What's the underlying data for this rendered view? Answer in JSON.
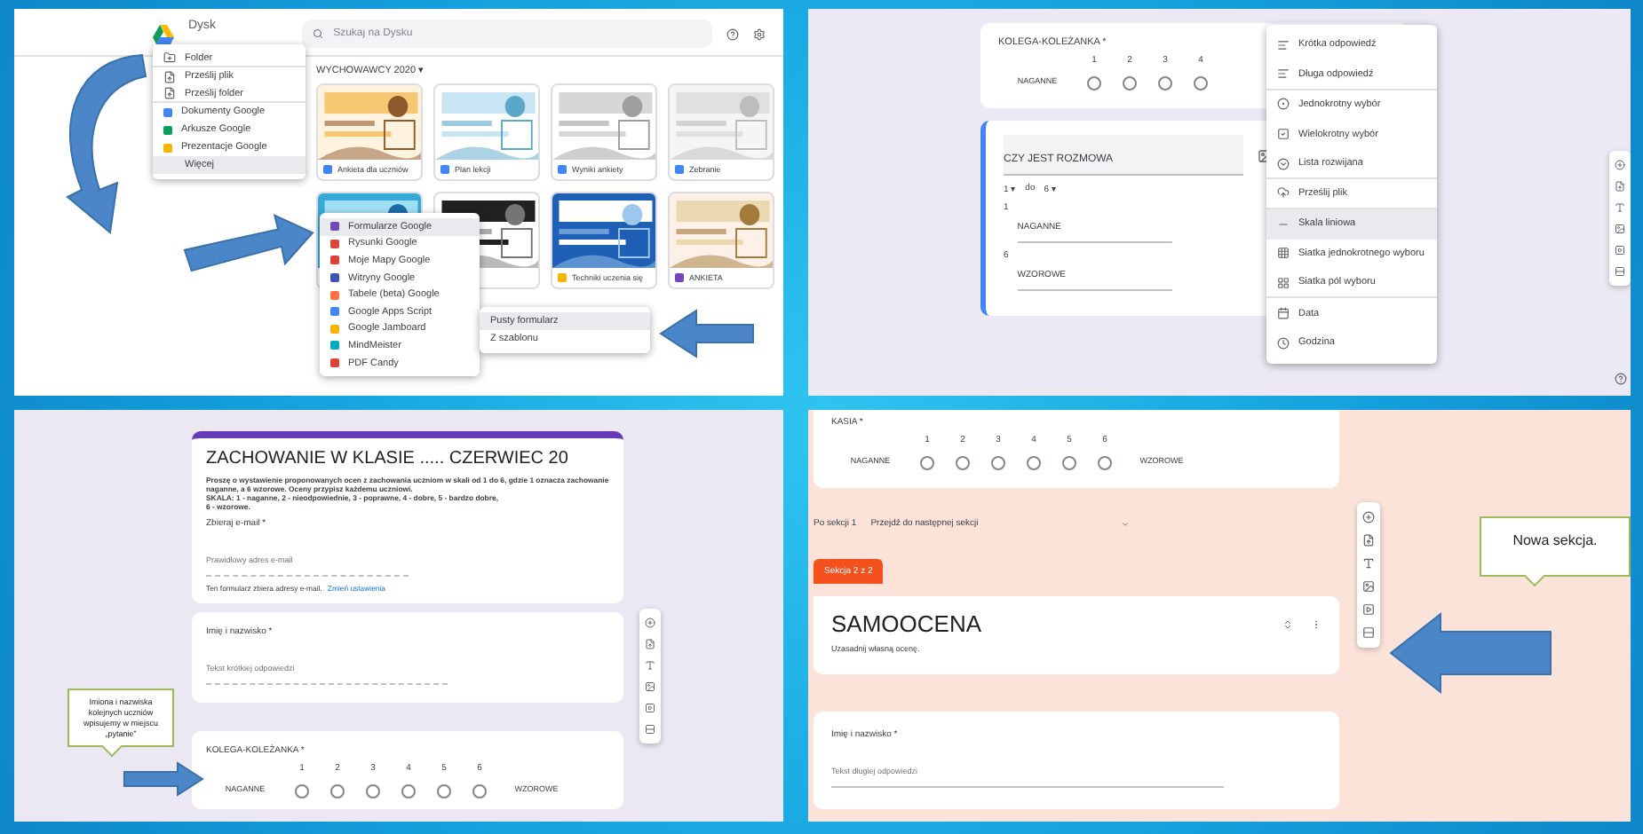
{
  "drive_screen": {
    "app_name": "Dysk",
    "search": {
      "placeholder": "Szukaj na Dysku"
    },
    "breadcrumb": "WYCHOWAWCY 2020 ▾",
    "new_menu": [
      {
        "label": "Folder",
        "kind": "folder",
        "selected": false
      },
      {
        "label": "Prześlij plik",
        "kind": "upload",
        "selected": false
      },
      {
        "label": "Prześlij folder",
        "kind": "upload",
        "selected": false
      },
      {
        "label": "Dokumenty Google",
        "kind": "app",
        "color": "#4285f4",
        "selected": false
      },
      {
        "label": "Arkusze Google",
        "kind": "app",
        "color": "#0f9d58",
        "selected": false
      },
      {
        "label": "Prezentacje Google",
        "kind": "app",
        "color": "#f4b400",
        "selected": false
      },
      {
        "label": "Więcej",
        "kind": "more",
        "selected": true
      }
    ],
    "more_menu": [
      {
        "label": "Formularze Google",
        "color": "#7248b9",
        "selected": true
      },
      {
        "label": "Rysunki Google",
        "color": "#db4437",
        "selected": false
      },
      {
        "label": "Moje Mapy Google",
        "color": "#db4437",
        "selected": false
      },
      {
        "label": "Witryny Google",
        "color": "#3f51b5",
        "selected": false
      },
      {
        "label": "Tabele (beta) Google",
        "color": "#ff7043",
        "selected": false
      },
      {
        "label": "Google Apps Script",
        "color": "#4285f4",
        "selected": false
      },
      {
        "label": "Google Jamboard",
        "color": "#f4b400",
        "selected": false
      },
      {
        "label": "MindMeister",
        "color": "#00acc1",
        "selected": false
      },
      {
        "label": "PDF Candy",
        "color": "#db4437",
        "selected": false
      }
    ],
    "form_menu": [
      {
        "label": "Pusty formularz",
        "selected": true
      },
      {
        "label": "Z szablonu",
        "selected": false
      }
    ],
    "files": [
      {
        "kind": "file",
        "caption": "Ankieta dla uczniów",
        "color": "#4285f4"
      },
      {
        "kind": "file",
        "caption": "Plan lekcji",
        "color": "#4285f4"
      },
      {
        "kind": "file",
        "caption": "Wyniki ankiety",
        "color": "#4285f4"
      },
      {
        "kind": "file",
        "caption": "Zebranie",
        "color": "#4285f4"
      },
      {
        "kind": "picture"
      },
      {
        "kind": "picture"
      },
      {
        "kind": "file",
        "caption": "Techniki uczenia się",
        "color": "#f4b400"
      },
      {
        "kind": "file",
        "caption": "ANKIETA",
        "color": "#7248b9"
      }
    ]
  },
  "question_type_screen": {
    "scale_card": {
      "title": "KOLEGA-KOLEŻANKA *",
      "points": [
        {
          "label": "1",
          "selected": false
        },
        {
          "label": "2",
          "selected": false
        },
        {
          "label": "3",
          "selected": false
        },
        {
          "label": "4",
          "selected": false
        }
      ],
      "low_label": "NAGANNE"
    },
    "edit_card": {
      "question": "CZY JEST ROZMOWA",
      "from": "1 ▾",
      "to_word": "do",
      "to": "6 ▾",
      "low": {
        "number": "1",
        "label": "NAGANNE"
      },
      "high": {
        "number": "6",
        "label": "WZOROWE"
      }
    },
    "type_menu": [
      {
        "label": "Krótka odpowiedź",
        "kind": "short",
        "selected": false
      },
      {
        "label": "Długa odpowiedź",
        "kind": "long",
        "selected": false
      },
      {
        "label": "Jednokrotny wybór",
        "kind": "radio",
        "selected": false
      },
      {
        "label": "Wielokrotny wybór",
        "kind": "check",
        "selected": false
      },
      {
        "label": "Lista rozwijana",
        "kind": "dropdown",
        "selected": false
      },
      {
        "label": "Prześlij plik",
        "kind": "upload",
        "selected": false
      },
      {
        "label": "Skala liniowa",
        "kind": "scale",
        "selected": true
      },
      {
        "label": "Siatka jednokrotnego wyboru",
        "kind": "grid",
        "selected": false
      },
      {
        "label": "Siatka pól wyboru",
        "kind": "checkgrid",
        "selected": false
      },
      {
        "label": "Data",
        "kind": "date",
        "selected": false
      },
      {
        "label": "Godzina",
        "kind": "time",
        "selected": false
      }
    ]
  },
  "form_screen": {
    "title": "ZACHOWANIE W KLASIE ..... CZERWIEC 20",
    "description": "Proszę o wystawienie proponowanych ocen z zachowania uczniom w skali od 1 do 6, gdzie 1 oznacza zachowanie naganne, a 6 wzorowe. Oceny przypisz każdemu uczniowi.\nSKALA: 1 - naganne, 2 - nieodpowiednie, 3 - poprawne, 4 - dobre, 5 - bardzo dobre,\n6 - wzorowe.",
    "email_label": "Zbieraj e-mail *",
    "email_placeholder": "Prawidłowy adres e-mail",
    "email_note": "Ten formularz zbiera adresy e-mail.",
    "email_link": "Zmień ustawienia",
    "name_label": "Imię i nazwisko *",
    "name_placeholder": "Tekst krótkiej odpowiedzi",
    "scale_card": {
      "title": "KOLEGA-KOLEŻANKA *",
      "points": [
        {
          "label": "1",
          "selected": false
        },
        {
          "label": "2",
          "selected": false
        },
        {
          "label": "3",
          "selected": false
        },
        {
          "label": "4",
          "selected": false
        },
        {
          "label": "5",
          "selected": false
        },
        {
          "label": "6",
          "selected": false
        }
      ],
      "low_label": "NAGANNE",
      "high_label": "WZOROWE"
    },
    "callout": "Imiona i nazwiska kolejnych uczniów wpisujemy w miejscu „pytanie”"
  },
  "section_screen": {
    "scale_card": {
      "title": "KASIA *",
      "points": [
        {
          "label": "1",
          "selected": false
        },
        {
          "label": "2",
          "selected": false
        },
        {
          "label": "3",
          "selected": false
        },
        {
          "label": "4",
          "selected": false
        },
        {
          "label": "5",
          "selected": false
        },
        {
          "label": "6",
          "selected": false
        }
      ],
      "low_label": "NAGANNE",
      "high_label": "WZOROWE"
    },
    "after_section": "Po sekcji 1",
    "after_action": "Przejdź do następnej sekcji",
    "section_tag": "Sekcja 2 z 2",
    "section_title": "SAMOOCENA",
    "section_description": "Uzasadnij własną ocenę.",
    "name_label": "Imię i nazwisko *",
    "name_placeholder": "Tekst długiej odpowiedzi",
    "callout": "Nowa sekcja."
  }
}
